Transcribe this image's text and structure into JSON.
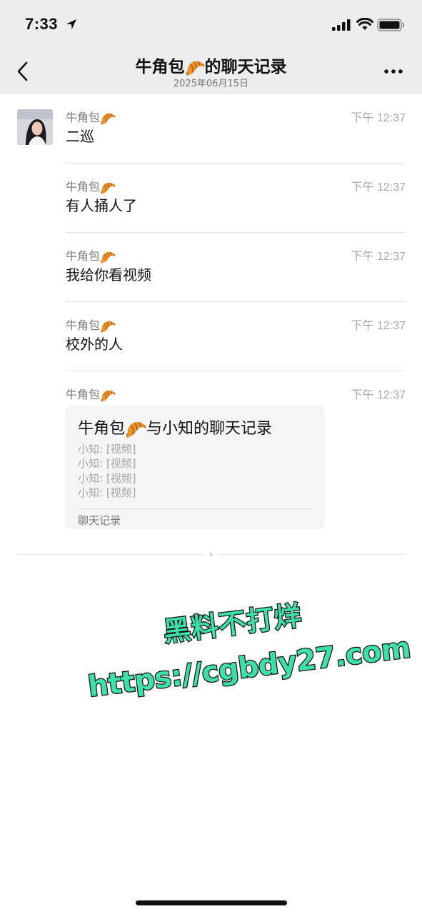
{
  "status_bar": {
    "time": "7:33"
  },
  "header": {
    "title": "牛角包",
    "title_suffix": "的聊天记录",
    "date": "2025年06月15日"
  },
  "messages": [
    {
      "sender": "牛角包",
      "time": "下午 12:37",
      "text": "二巡"
    },
    {
      "sender": "牛角包",
      "time": "下午 12:37",
      "text": "有人捅人了"
    },
    {
      "sender": "牛角包",
      "time": "下午 12:37",
      "text": "我给你看视频"
    },
    {
      "sender": "牛角包",
      "time": "下午 12:37",
      "text": "校外的人"
    },
    {
      "sender": "牛角包",
      "time": "下午 12:37",
      "text": ""
    }
  ],
  "card": {
    "title_prefix": "牛角包",
    "title_suffix": "与小知的聊天记录",
    "lines": [
      "小知: [视频]",
      "小知: [视频]",
      "小知: [视频]",
      "小知: [视频]"
    ],
    "footer": "聊天记录"
  },
  "watermark": {
    "line1": "黑料不打烊",
    "line2": "https://cgbdy27.com",
    "fill": "#3fe0a8",
    "outline": "#111111"
  },
  "icons": [
    "location-arrow-icon",
    "signal-icon",
    "wifi-icon",
    "battery-icon",
    "back-icon",
    "more-icon",
    "croissant-emoji-icon"
  ]
}
